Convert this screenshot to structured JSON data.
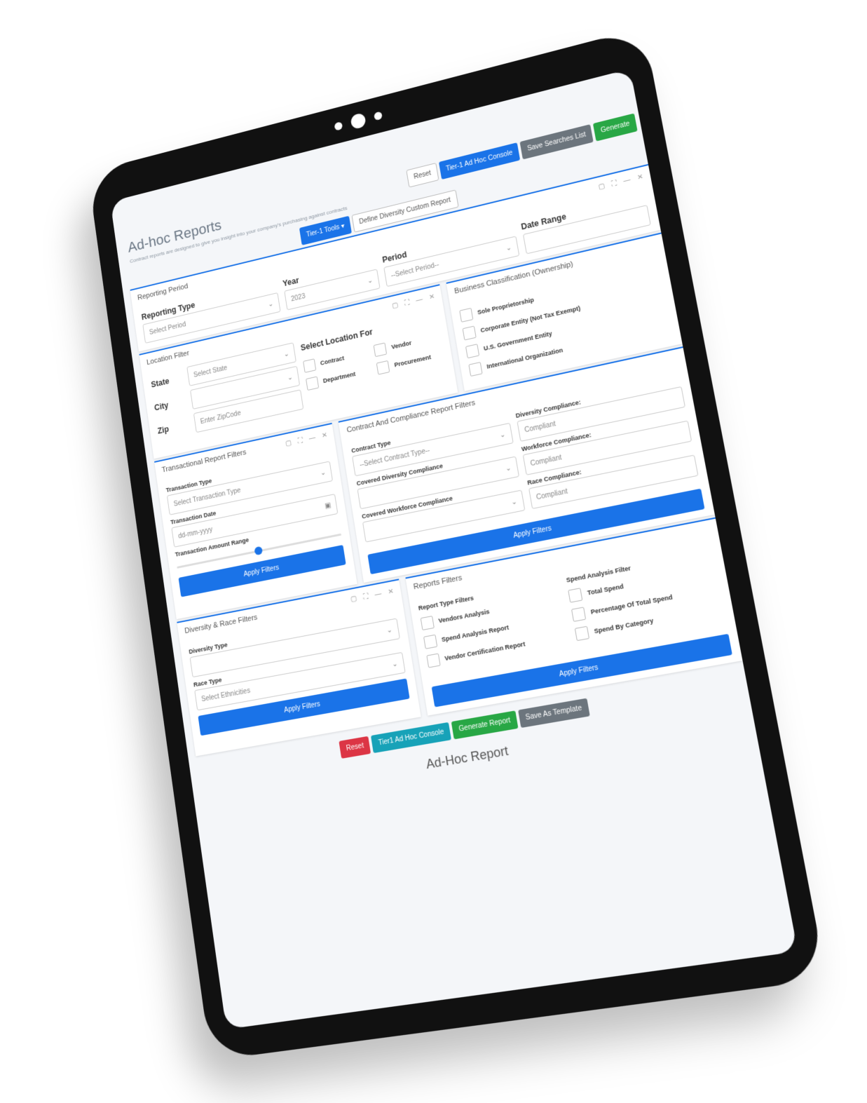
{
  "page": {
    "title": "Ad-hoc Reports",
    "subtitle": "Contract reports are designed to give you insight into your company's purchasing against contracts"
  },
  "top_buttons": {
    "reset": "Reset",
    "tier1_console": "Tier-1 Ad Hoc Console",
    "saved_searches": "Save Searches List",
    "generate": "Generate"
  },
  "toolbar": {
    "tier1_tools": "Tier-1 Tools ▾",
    "define_diversity": "Define Diversity Custom Report"
  },
  "date_range": {
    "label": "Date Range"
  },
  "reporting_period": {
    "title": "Reporting Period",
    "type_label": "Reporting Type",
    "type_value": "Select Period",
    "year_label": "Year",
    "year_value": "2023",
    "period_label": "Period",
    "period_value": "--Select Period--"
  },
  "business_classification": {
    "title": "Business Classification (Ownership)",
    "items": [
      "Sole Proprietorship",
      "Corporate Entity (Not Tax Exempt)",
      "U.S. Government Entity",
      "International Organization"
    ]
  },
  "location_filter": {
    "title": "Location Filter",
    "state_label": "State",
    "state_value": "Select State",
    "city_label": "City",
    "zip_label": "Zip",
    "zip_placeholder": "Enter ZipCode",
    "select_for_label": "Select Location For",
    "options": [
      "Contract",
      "Vendor",
      "Department",
      "Procurement"
    ]
  },
  "transactional": {
    "title": "Transactional Report Filters",
    "type_label": "Transaction Type",
    "type_value": "Select Transaction Type",
    "date_label": "Transaction Date",
    "date_placeholder": "dd-mm-yyyy",
    "range_label": "Transaction Amount Range",
    "range_fraction": 0.5,
    "apply": "Apply Filters"
  },
  "contract_compliance": {
    "title": "Contract And Compliance Report Filters",
    "contract_type_label": "Contract Type",
    "contract_type_value": "--Select Contract Type--",
    "covered_diversity_label": "Covered Diversity Compliance",
    "covered_workforce_label": "Covered Workforce Compliance",
    "diversity_label": "Diversity Compliance:",
    "diversity_value": "Compliant",
    "workforce_label": "Workforce Compliance:",
    "workforce_value": "Compliant",
    "race_label": "Race Compliance:",
    "race_value": "Compliant",
    "apply": "Apply Filters"
  },
  "diversity_race": {
    "title": "Diversity & Race Filters",
    "diversity_type_label": "Diversity Type",
    "race_type_label": "Race Type",
    "race_type_value": "Select Ethnicities",
    "apply": "Apply Filters"
  },
  "reports_filters": {
    "title": "Reports Filters",
    "report_type_label": "Report Type Filters",
    "report_types": [
      "Vendors Analysis",
      "Spend Analysis Report",
      "Vendor Certification Report"
    ],
    "spend_label": "Spend Analysis Filter",
    "spend_items": [
      "Total Spend",
      "Percentage Of Total Spend",
      "Spend By Category"
    ],
    "apply": "Apply Filters"
  },
  "footer_buttons": {
    "reset": "Reset",
    "tier1_console": "Tier1 Ad Hoc Console",
    "generate": "Generate Report",
    "save_template": "Save As Template"
  },
  "footer_title": "Ad-Hoc Report"
}
